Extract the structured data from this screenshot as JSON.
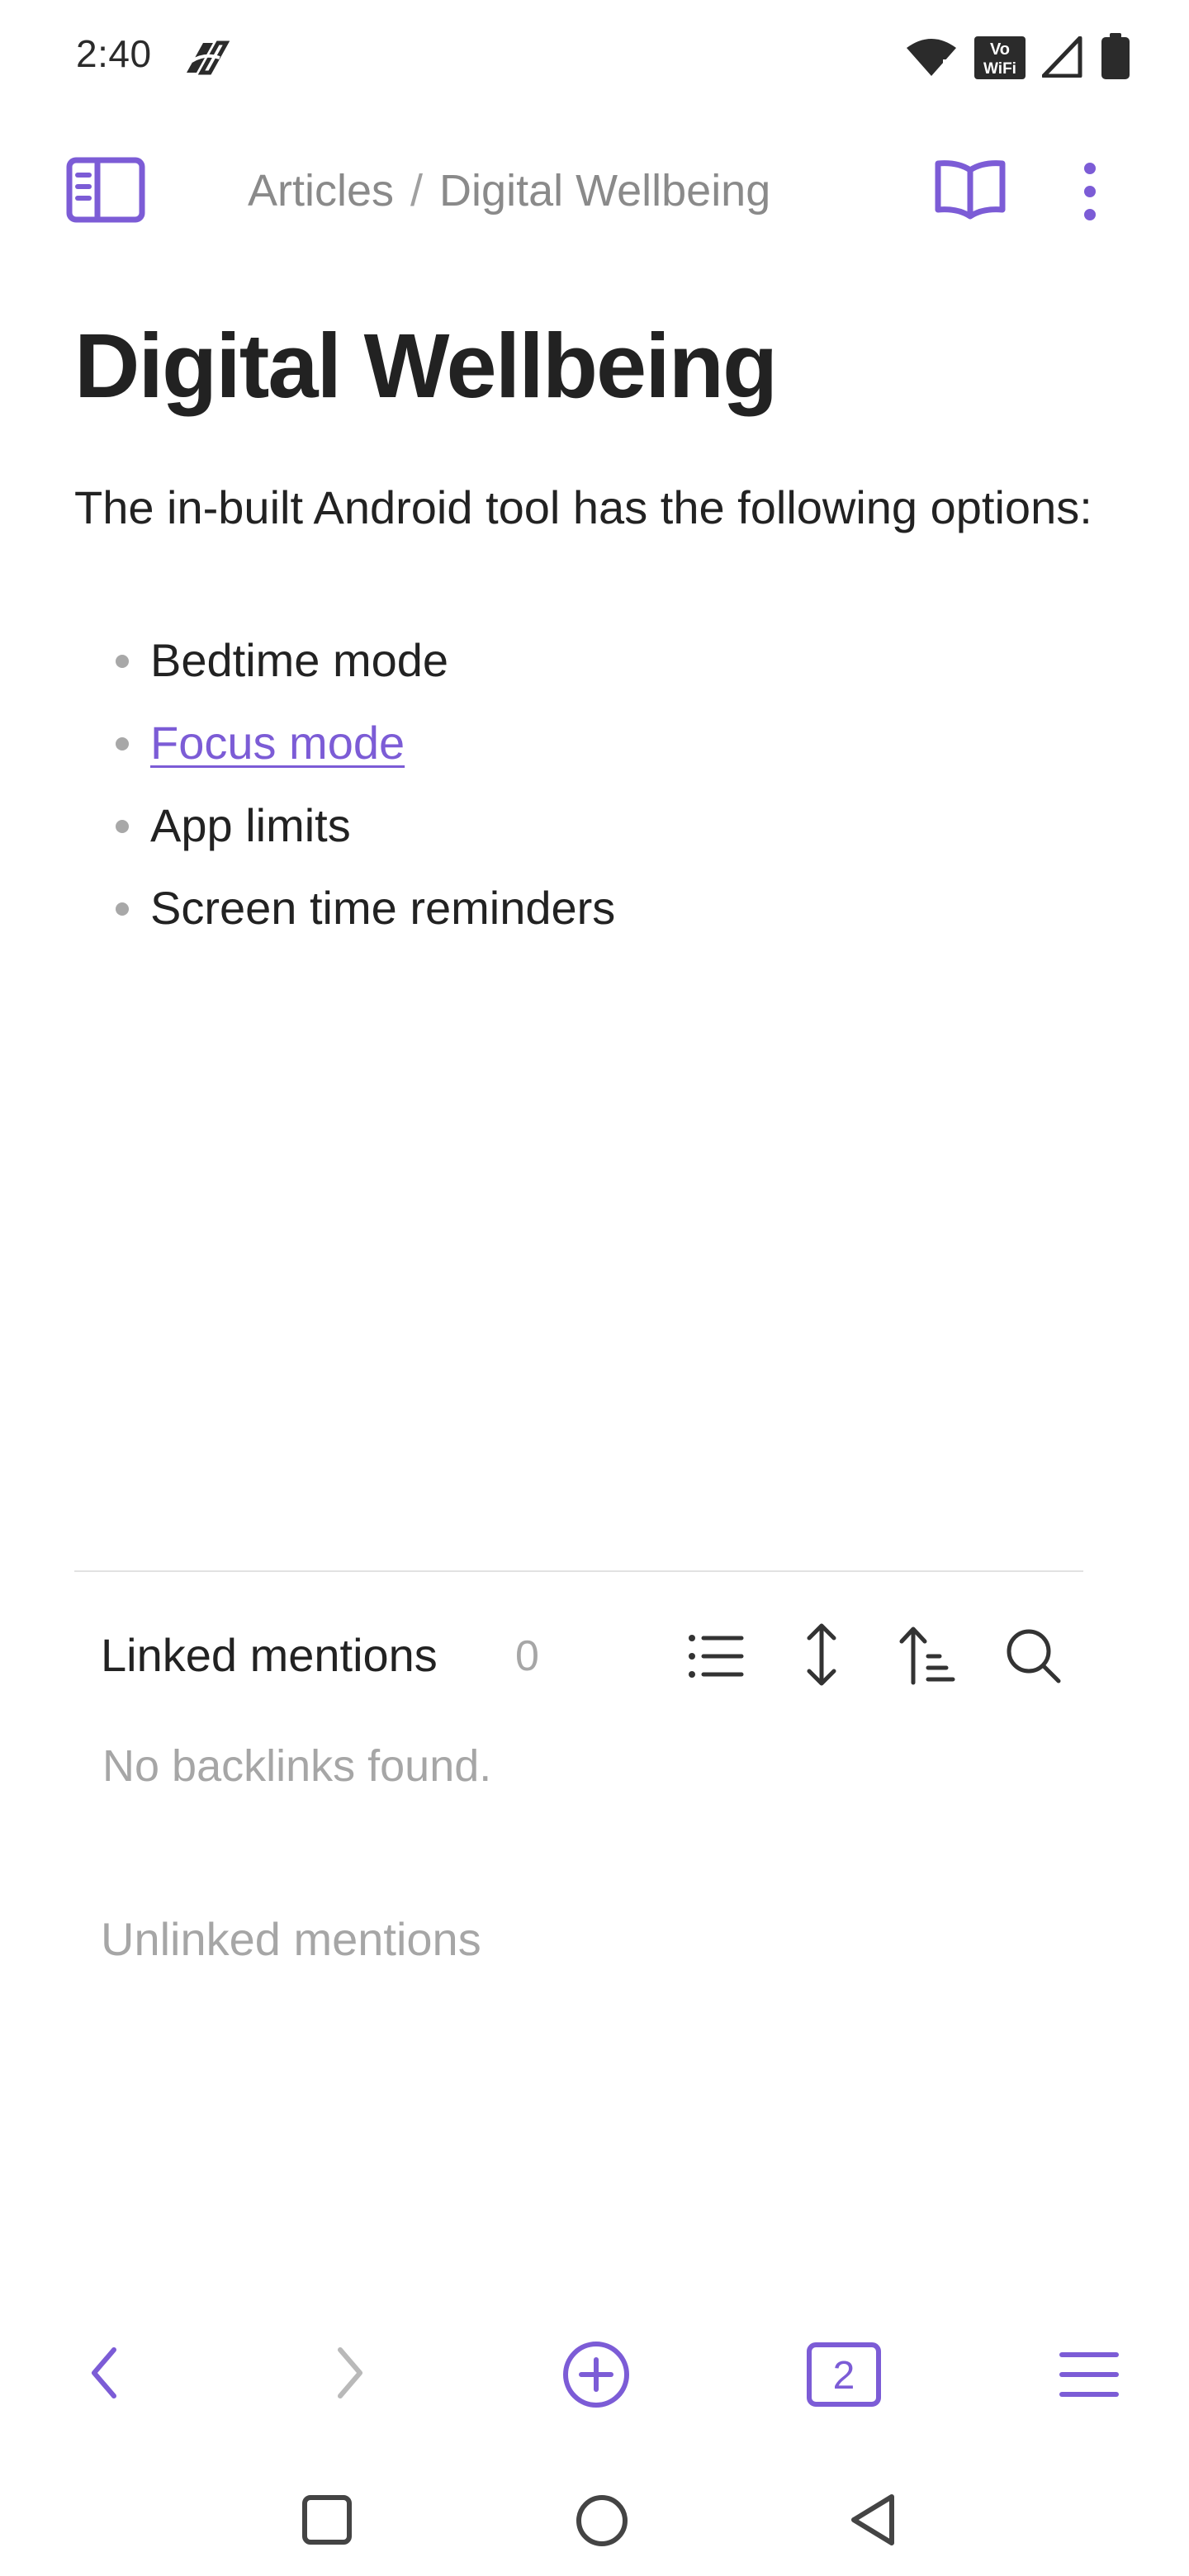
{
  "status_bar": {
    "time": "2:40",
    "vowifi_line1": "Vo",
    "vowifi_line2": "WiFi"
  },
  "top_bar": {
    "breadcrumb_folder": "Articles",
    "breadcrumb_separator": "/",
    "breadcrumb_note": "Digital Wellbeing"
  },
  "note": {
    "title": "Digital Wellbeing",
    "paragraph": "The in-built Android tool has the following options:",
    "bullets": [
      {
        "text": "Bedtime mode",
        "is_link": false
      },
      {
        "text": "Focus mode",
        "is_link": true
      },
      {
        "text": "App limits",
        "is_link": false
      },
      {
        "text": "Screen time reminders",
        "is_link": false
      }
    ]
  },
  "backlinks": {
    "linked_title": "Linked mentions",
    "linked_count": "0",
    "empty_message": "No backlinks found.",
    "unlinked_title": "Unlinked mentions"
  },
  "bottom_toolbar": {
    "tab_count": "2"
  },
  "icons": {
    "sidebar_toggle": "sidebar-toggle-icon",
    "reading_view": "book-open-icon",
    "more_options": "more-vertical-icon",
    "list_view": "list-icon",
    "expand_collapse": "expand-vertical-icon",
    "sort": "sort-icon",
    "search": "search-icon",
    "back": "chevron-left-icon",
    "forward": "chevron-right-icon",
    "new_note": "plus-circle-icon",
    "tabs": "tabs-count-icon",
    "menu": "menu-icon",
    "nav_recents": "square-icon",
    "nav_home": "circle-icon",
    "nav_back": "triangle-back-icon"
  },
  "colors": {
    "accent": "#7c5cd6",
    "text": "#222222",
    "muted": "#a6a6a6"
  }
}
